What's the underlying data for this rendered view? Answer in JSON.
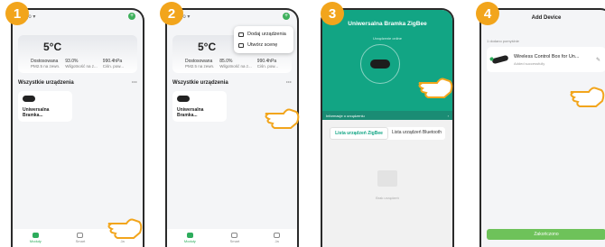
{
  "accent_orange": "#f2a51c",
  "accent_green": "#2dac5c",
  "steps": [
    "1",
    "2",
    "3",
    "4"
  ],
  "home": {
    "location": "Ergo ▾",
    "temperature": "5°C",
    "weather": [
      {
        "value": "93.0%",
        "label": "Wilgotność na z..."
      },
      {
        "value": "990.4hPa",
        "label": "Ciśn. pow..."
      }
    ],
    "outdoor_label": "Dostosowana",
    "outdoor_sub": "PM2.5 na zewn.",
    "section_title": "Wszystkie urządzenia",
    "more": "···",
    "device_name": "Uniwersalna Bramka...",
    "tabs": [
      "Moduły",
      "Smart",
      "Ja"
    ]
  },
  "screen2": {
    "menu": [
      "Dodaj urządzenia",
      "Utwórz scenę"
    ],
    "weather_values": [
      "85.0%",
      "990.4hPa"
    ]
  },
  "gateway": {
    "title": "Uniwersalna Bramka ZigBee",
    "status": "Urządzenie online",
    "info": "Informacje o urządzeniu",
    "tabs": [
      "Lista urządzeń ZigBee",
      "Lista urządzeń Bluetooth"
    ],
    "empty": "Brak urządzeń"
  },
  "add_device": {
    "title": "Add Device",
    "added_count": "1 dodano pomyślnie",
    "device_name": "Wireless Control Box for Un...",
    "device_status": "Added successfully",
    "done": "Zakończono"
  }
}
